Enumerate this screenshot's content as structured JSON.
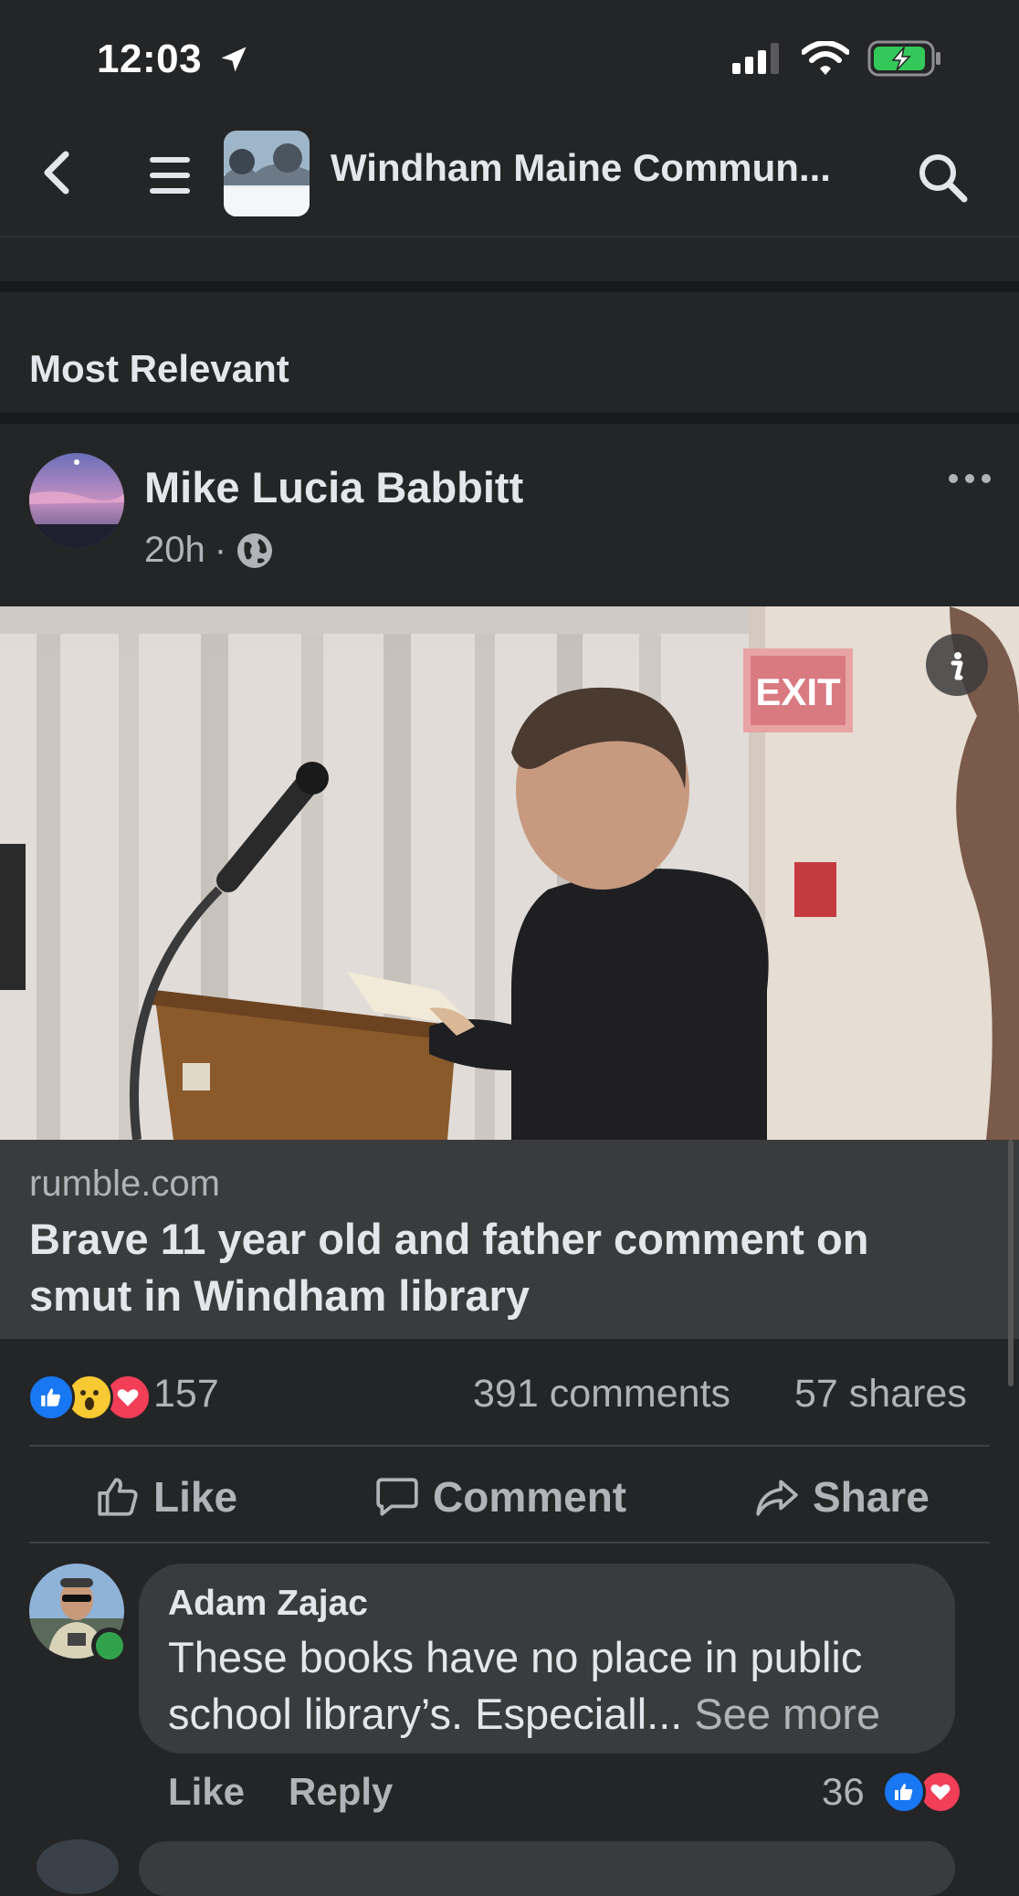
{
  "status_bar": {
    "time": "12:03"
  },
  "header": {
    "title": "Windham Maine Commun..."
  },
  "section": {
    "title": "Most Relevant"
  },
  "post": {
    "author": "Mike Lucia Babbitt",
    "time": "20h",
    "meta_separator": "·",
    "link": {
      "domain": "rumble.com",
      "title": "Brave 11 year old and father comment on smut in Windham library"
    },
    "stats": {
      "reaction_count": "157",
      "comments": "391 comments",
      "shares": "57 shares"
    },
    "actions": {
      "like": "Like",
      "comment": "Comment",
      "share": "Share"
    }
  },
  "comment": {
    "name": "Adam Zajac",
    "text": "These books have no place in public school library’s. Especiall...",
    "see_more": " See more",
    "like": "Like",
    "reply": "Reply",
    "reaction_count": "36"
  },
  "colors": {
    "background": "#242526",
    "bubble": "#3a3b3c",
    "like_blue": "#1877f2",
    "love_red": "#f33e58",
    "online_green": "#31a24c"
  }
}
